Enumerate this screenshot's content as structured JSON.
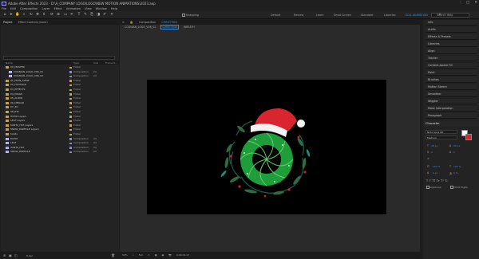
{
  "window": {
    "title": "Adobe After Effects 2023 - D:\\A_COMPANY LOGO\\LOGO\\NEW MOTION ANIMATIONS\\2023.aep",
    "controls": [
      "–",
      "□",
      "✕"
    ]
  },
  "menu": [
    "File",
    "Edit",
    "Composition",
    "Layer",
    "Effect",
    "Animation",
    "View",
    "Window",
    "Help"
  ],
  "toolbar": {
    "snapping_label": "Snapping",
    "workspaces": [
      "Default",
      "Review",
      "Learn",
      "Small Screen",
      "Standard",
      "Libraries"
    ],
    "active_workspace": "EDIL ANIMATION",
    "search_placeholder": "Search Help"
  },
  "project": {
    "tabs": [
      "Project",
      "Effect Controls (none)"
    ],
    "columns": [
      "Name",
      "Type",
      "Size",
      "Frame R..."
    ],
    "items": [
      {
        "name": "00_MASTER",
        "type": "Folder",
        "size": "",
        "icon": "folder",
        "color": "#c8a24a",
        "indent": 0
      },
      {
        "name": "COGNIAN_LOGO_V06_01",
        "type": "Composition",
        "size": "24",
        "icon": "comp",
        "color": "#8a8ad0",
        "indent": 1
      },
      {
        "name": "COGNIAN_LOGO_V06_02",
        "type": "Composition",
        "size": "24",
        "icon": "comp",
        "color": "#8a8ad0",
        "indent": 1
      },
      {
        "name": "01_MAIN_COMP",
        "type": "Folder",
        "size": "",
        "icon": "folder",
        "color": "#c8a24a",
        "indent": 0
      },
      {
        "name": "02_FOOTAGE",
        "type": "Folder",
        "size": "",
        "icon": "folder",
        "color": "#c8a24a",
        "indent": 0
      },
      {
        "name": "03_EFFECTS",
        "type": "Folder",
        "size": "",
        "icon": "folder",
        "color": "#c8a24a",
        "indent": 0
      },
      {
        "name": "04_IMAGE",
        "type": "Folder",
        "size": "",
        "icon": "folder",
        "color": "#c8a24a",
        "indent": 0
      },
      {
        "name": "05_AUDIO",
        "type": "Folder",
        "size": "",
        "icon": "folder",
        "color": "#c8a24a",
        "indent": 0
      },
      {
        "name": "06_DESIGN",
        "type": "Folder",
        "size": "",
        "icon": "folder",
        "color": "#c8a24a",
        "indent": 0
      },
      {
        "name": "07_3D",
        "type": "Folder",
        "size": "",
        "icon": "folder",
        "color": "#c8a24a",
        "indent": 0
      },
      {
        "name": "08_ETC",
        "type": "Folder",
        "size": "",
        "icon": "folder",
        "color": "#c8a24a",
        "indent": 0
      },
      {
        "name": "HOHO Layers",
        "type": "Folder",
        "size": "",
        "icon": "folder",
        "color": "#c8a24a",
        "indent": 0
      },
      {
        "name": "LEAF Layers",
        "type": "Folder",
        "size": "",
        "icon": "folder",
        "color": "#c8a24a",
        "indent": 0
      },
      {
        "name": "SANTA_HAT Layers",
        "type": "Folder",
        "size": "",
        "icon": "folder",
        "color": "#c8a24a",
        "indent": 0
      },
      {
        "name": "SNOW_PARTICLE Layers",
        "type": "Folder",
        "size": "",
        "icon": "folder",
        "color": "#c8a24a",
        "indent": 0
      },
      {
        "name": "Solids",
        "type": "Folder",
        "size": "",
        "icon": "folder",
        "color": "#c8a24a",
        "indent": 0
      },
      {
        "name": "HOHO",
        "type": "Composition",
        "size": "24",
        "icon": "comp",
        "color": "#8a8ad0",
        "indent": 0
      },
      {
        "name": "LEAF",
        "type": "Composition",
        "size": "24",
        "icon": "comp",
        "color": "#8a8ad0",
        "indent": 0
      },
      {
        "name": "SANTA_HAT",
        "type": "Composition",
        "size": "24",
        "icon": "comp",
        "color": "#8a8ad0",
        "indent": 0
      },
      {
        "name": "SNOW_PARTICLE",
        "type": "Composition",
        "size": "24",
        "icon": "comp",
        "color": "#8a8ad0",
        "indent": 0
      }
    ],
    "footer_bpc": "8 bpc"
  },
  "viewer": {
    "tab_label": "Composition",
    "comp_name": "CHRISTMAS",
    "breadcrumbs": [
      "COGNIAN_LOGO_V06_02",
      "CHRISTMAS",
      "WREATH"
    ],
    "zoom": "50%",
    "resolution": "Full",
    "timecode": "0:00:01:17"
  },
  "right_panels": [
    "Info",
    "Audio",
    "Effects & Presets",
    "Libraries",
    "Align",
    "Tracker",
    "Content-Aware Fill",
    "Paint",
    "Brushes",
    "Motion Sketch",
    "Smoother",
    "Wiggler",
    "Mask Interpolation",
    "Paragraph"
  ],
  "character": {
    "title": "Character",
    "font_family": "Noto Sans KR",
    "font_style": "Medium",
    "size": "48 px",
    "leading": "60 px",
    "kerning": "0",
    "tracking": "0",
    "scale_v": "100 %",
    "scale_h": "100 %",
    "baseline": "0 px",
    "tsume": "0 %",
    "ligatures_label": "Ligatures",
    "hindi_digits_label": "Hindi Digits"
  },
  "colors": {
    "accent": "#2d8ceb",
    "wreath_green": "#1f9d3a",
    "hat_red": "#d9262e"
  }
}
